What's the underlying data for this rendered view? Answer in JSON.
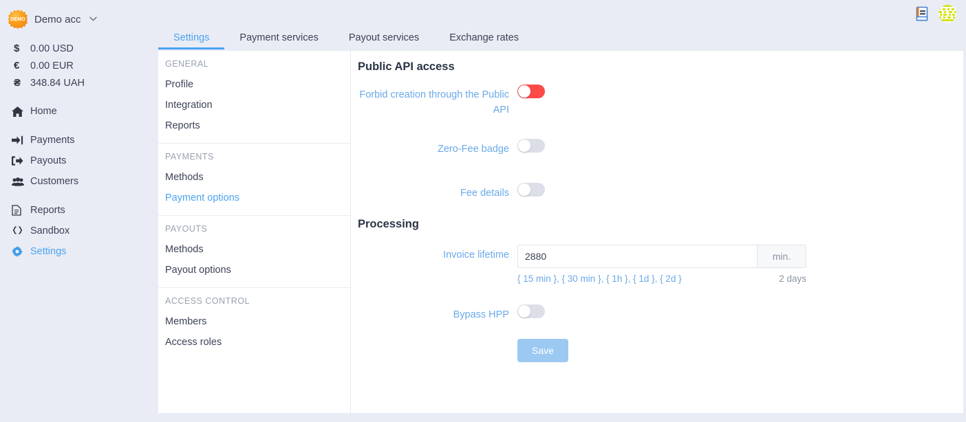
{
  "account": {
    "logo_text": "DEMO",
    "name": "Demo acc",
    "caret_icon": "chevron-down-icon"
  },
  "balances": [
    {
      "symbol": "$",
      "symbol_icon": "dollar-sign-icon",
      "value": "0.00 USD"
    },
    {
      "symbol": "€",
      "symbol_icon": "euro-sign-icon",
      "value": "0.00 EUR"
    },
    {
      "symbol": "₴",
      "symbol_icon": "hryvnia-sign-icon",
      "value": "348.84 UAH"
    }
  ],
  "nav": {
    "group1": [
      {
        "label": "Home",
        "icon": "home-icon",
        "active": false
      }
    ],
    "group2": [
      {
        "label": "Payments",
        "icon": "sign-in-arrow-icon",
        "active": false
      },
      {
        "label": "Payouts",
        "icon": "sign-out-arrow-icon",
        "active": false
      },
      {
        "label": "Customers",
        "icon": "users-icon",
        "active": false
      }
    ],
    "group3": [
      {
        "label": "Reports",
        "icon": "document-icon",
        "active": false
      },
      {
        "label": "Sandbox",
        "icon": "code-braces-icon",
        "active": false
      },
      {
        "label": "Settings",
        "icon": "gear-icon",
        "active": true
      }
    ]
  },
  "topbar": {
    "book_icon": "book-icon",
    "avatar_icon": "identicon-avatar"
  },
  "tabs": [
    {
      "label": "Settings",
      "active": true
    },
    {
      "label": "Payment services",
      "active": false
    },
    {
      "label": "Payout services",
      "active": false
    },
    {
      "label": "Exchange rates",
      "active": false
    }
  ],
  "submenu": [
    {
      "heading": "GENERAL",
      "items": [
        {
          "label": "Profile",
          "active": false
        },
        {
          "label": "Integration",
          "active": false
        },
        {
          "label": "Reports",
          "active": false
        }
      ]
    },
    {
      "heading": "PAYMENTS",
      "items": [
        {
          "label": "Methods",
          "active": false
        },
        {
          "label": "Payment options",
          "active": true
        }
      ]
    },
    {
      "heading": "PAYOUTS",
      "items": [
        {
          "label": "Methods",
          "active": false
        },
        {
          "label": "Payout options",
          "active": false
        }
      ]
    },
    {
      "heading": "ACCESS CONTROL",
      "items": [
        {
          "label": "Members",
          "active": false
        },
        {
          "label": "Access roles",
          "active": false
        }
      ]
    }
  ],
  "form": {
    "section_api_title": "Public API access",
    "forbid_label": "Forbid creation through the Public API",
    "forbid_state": "on",
    "zero_fee_label": "Zero-Fee badge",
    "zero_fee_state": "off",
    "fee_details_label": "Fee details",
    "fee_details_state": "off",
    "section_processing_title": "Processing",
    "invoice_lifetime_label": "Invoice lifetime",
    "invoice_lifetime_value": "2880",
    "invoice_lifetime_placeholder": "2880",
    "invoice_lifetime_unit": "min.",
    "invoice_lifetime_presets": "{ 15 min }, { 30 min }, { 1h }, { 1d }, { 2d }",
    "invoice_lifetime_human": "2 days",
    "bypass_hpp_label": "Bypass HPP",
    "bypass_hpp_state": "off",
    "save_label": "Save"
  },
  "colors": {
    "accent": "#4aa3f0",
    "link": "#6aa9e9",
    "toggle_on": "#fc4a49",
    "toggle_off": "#dcdfe8",
    "save_bg": "#9cc9f2",
    "app_bg": "#e9ecf5",
    "panel_bg": "#ffffff",
    "brand_orange": "#f99b1c"
  }
}
